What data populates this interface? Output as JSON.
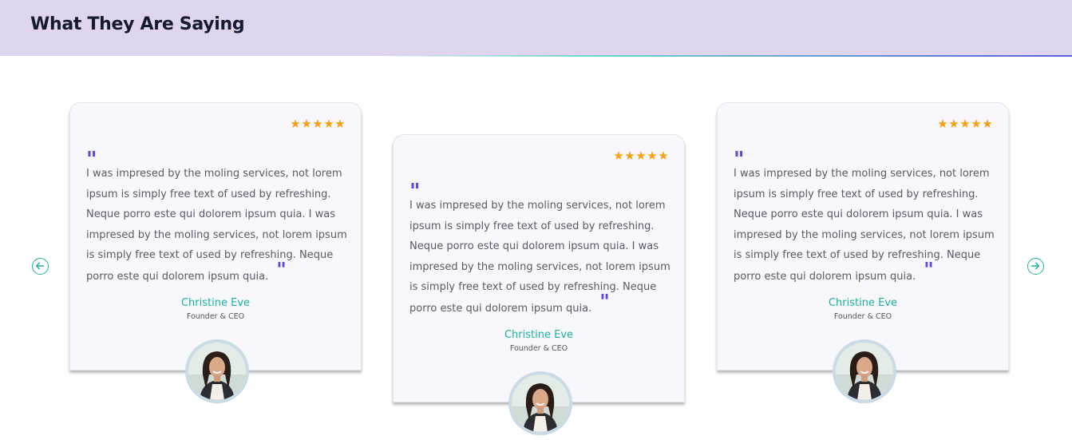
{
  "header": {
    "title": "What They Are Saying"
  },
  "testimonials": [
    {
      "rating": 5,
      "quote": "I was impresed by the moling services, not lorem ipsum is simply free text of used by refreshing. Neque porro este qui dolorem ipsum quia. I was impresed by the moling services, not lorem ipsum is simply free text of used by refreshing. Neque porro este qui dolorem ipsum quia.",
      "name": "Christine Eve",
      "role": "Founder & CEO"
    },
    {
      "rating": 5,
      "quote": "I was impresed by the moling services, not lorem ipsum is simply free text of used by refreshing. Neque porro este qui dolorem ipsum quia. I was impresed by the moling services, not lorem ipsum is simply free text of used by refreshing. Neque porro este qui dolorem ipsum quia.",
      "name": "Christine Eve",
      "role": "Founder & CEO"
    },
    {
      "rating": 5,
      "quote": "I was impresed by the moling services, not lorem ipsum is simply free text of used by refreshing. Neque porro este qui dolorem ipsum quia. I was impresed by the moling services, not lorem ipsum is simply free text of used by refreshing. Neque porro este qui dolorem ipsum quia.",
      "name": "Christine Eve",
      "role": "Founder & CEO"
    }
  ],
  "icons": {
    "star": "star-icon",
    "quote_open": "quote-open-icon",
    "quote_close": "quote-close-icon",
    "prev": "arrow-left-circle-icon",
    "next": "arrow-right-circle-icon",
    "avatar": "avatar"
  },
  "colors": {
    "header_background": "#dfd6ee",
    "accent_teal": "#1bb2a0",
    "star_color": "#f7a012",
    "quote_color": "#5b4bd6",
    "card_background": "#f8f7fc"
  }
}
